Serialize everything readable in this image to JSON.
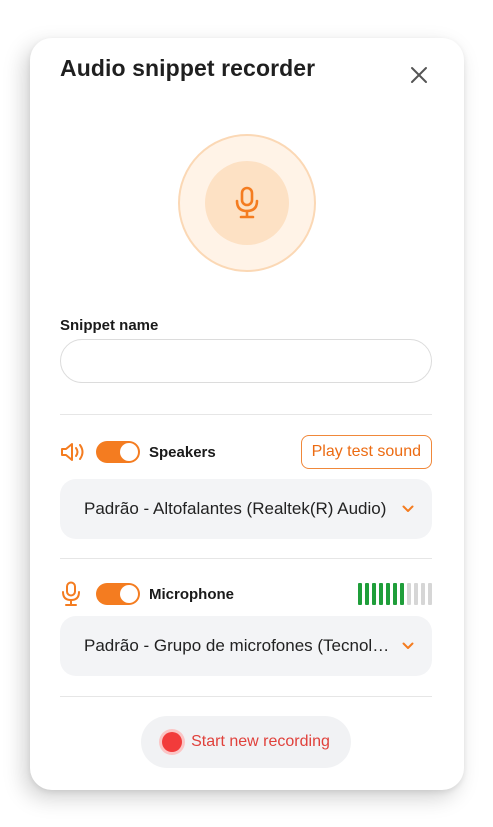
{
  "dialog": {
    "title": "Audio snippet recorder",
    "close_icon": "close-icon"
  },
  "colors": {
    "accent": "#f47c20",
    "accent_light": "#fde1c4",
    "level_on": "#1f9e3a",
    "level_off": "#d6d6d6",
    "record": "#f23b3b"
  },
  "snippet": {
    "label": "Snippet name",
    "value": "",
    "placeholder": ""
  },
  "speakers": {
    "icon": "speaker-icon",
    "enabled": true,
    "label": "Speakers",
    "test_button": "Play test sound",
    "device": "Padrão - Altofalantes (Realtek(R) Audio)"
  },
  "microphone": {
    "icon": "microphone-icon",
    "enabled": true,
    "label": "Microphone",
    "device": "Padrão - Grupo de microfones (Tecnologia Intel® Smart Sound)",
    "level_bars_total": 11,
    "level_bars_active": 7
  },
  "record": {
    "label": "Start new recording"
  }
}
